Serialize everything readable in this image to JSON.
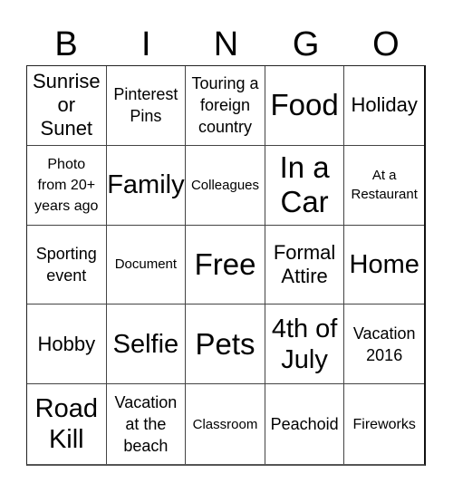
{
  "header": {
    "letters": [
      "B",
      "I",
      "N",
      "G",
      "O"
    ]
  },
  "cells": [
    {
      "text": "Sunrise or Sunet",
      "lines": [
        "Sunrise",
        "or",
        "Sunet"
      ],
      "size": "s-m"
    },
    {
      "text": "Pinterest Pins",
      "lines": [
        "Pinterest",
        "Pins"
      ],
      "size": "s-s"
    },
    {
      "text": "Touring a foreign country",
      "lines": [
        "Touring a",
        "foreign",
        "country"
      ],
      "size": "s-s"
    },
    {
      "text": "Food",
      "lines": [
        "Food"
      ],
      "size": "s-xl"
    },
    {
      "text": "Holiday",
      "lines": [
        "Holiday"
      ],
      "size": "s-m"
    },
    {
      "text": "Photo from 20+ years ago",
      "lines": [
        "Photo",
        "from 20+",
        "years ago"
      ],
      "size": "s-xs"
    },
    {
      "text": "Family",
      "lines": [
        "Family"
      ],
      "size": "s-l"
    },
    {
      "text": "Colleagues",
      "lines": [
        "Colleagues"
      ],
      "size": "s-xxs"
    },
    {
      "text": "In a Car",
      "lines": [
        "In a",
        "Car"
      ],
      "size": "s-xl"
    },
    {
      "text": "At a Restaurant",
      "lines": [
        "At a",
        "Restaurant"
      ],
      "size": "s-xxs"
    },
    {
      "text": "Sporting event",
      "lines": [
        "Sporting",
        "event"
      ],
      "size": "s-s"
    },
    {
      "text": "Document",
      "lines": [
        "Document"
      ],
      "size": "s-xxs"
    },
    {
      "text": "Free",
      "lines": [
        "Free"
      ],
      "size": "s-xl"
    },
    {
      "text": "Formal Attire",
      "lines": [
        "Formal",
        "Attire"
      ],
      "size": "s-m"
    },
    {
      "text": "Home",
      "lines": [
        "Home"
      ],
      "size": "s-l"
    },
    {
      "text": "Hobby",
      "lines": [
        "Hobby"
      ],
      "size": "s-m"
    },
    {
      "text": "Selfie",
      "lines": [
        "Selfie"
      ],
      "size": "s-l"
    },
    {
      "text": "Pets",
      "lines": [
        "Pets"
      ],
      "size": "s-xl"
    },
    {
      "text": "4th of July",
      "lines": [
        "4th of",
        "July"
      ],
      "size": "s-l"
    },
    {
      "text": "Vacation 2016",
      "lines": [
        "Vacation",
        "2016"
      ],
      "size": "s-s"
    },
    {
      "text": "Road Kill",
      "lines": [
        "Road",
        "Kill"
      ],
      "size": "s-l"
    },
    {
      "text": "Vacation at the beach",
      "lines": [
        "Vacation",
        "at the",
        "beach"
      ],
      "size": "s-s"
    },
    {
      "text": "Classroom",
      "lines": [
        "Classroom"
      ],
      "size": "s-xxs"
    },
    {
      "text": "Peachoid",
      "lines": [
        "Peachoid"
      ],
      "size": "s-s"
    },
    {
      "text": "Fireworks",
      "lines": [
        "Fireworks"
      ],
      "size": "s-xs"
    }
  ]
}
